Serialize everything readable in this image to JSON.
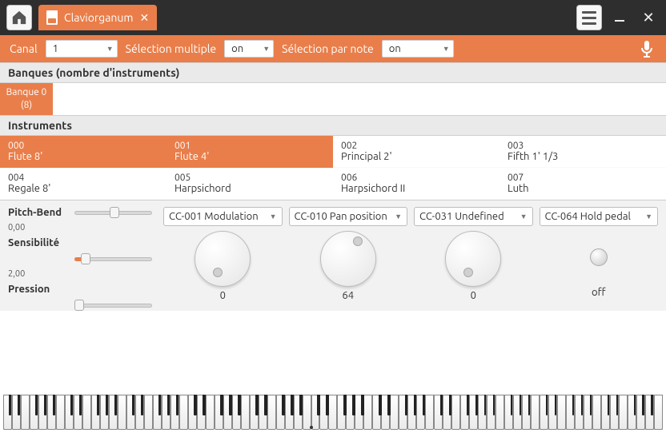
{
  "window": {
    "tab_title": "Claviorganum"
  },
  "selbar": {
    "canal_label": "Canal",
    "canal_value": "1",
    "multi_label": "Sélection multiple",
    "multi_value": "on",
    "note_label": "Sélection par note",
    "note_value": "on"
  },
  "sections": {
    "banks_header": "Banques (nombre d'instruments)",
    "instruments_header": "Instruments"
  },
  "bank": {
    "line1": "Banque 0",
    "line2": "(8)"
  },
  "instruments": [
    {
      "num": "000",
      "name": "Flute 8'",
      "selected": true
    },
    {
      "num": "001",
      "name": "Flute 4'",
      "selected": true
    },
    {
      "num": "002",
      "name": "Principal 2'",
      "selected": false
    },
    {
      "num": "003",
      "name": "Fifth 1' 1/3",
      "selected": false
    },
    {
      "num": "004",
      "name": "Regale 8'",
      "selected": false
    },
    {
      "num": "005",
      "name": "Harpsichord",
      "selected": false
    },
    {
      "num": "006",
      "name": "Harpsichord II",
      "selected": false
    },
    {
      "num": "007",
      "name": "Luth",
      "selected": false
    }
  ],
  "controls": {
    "pitchbend_label": "Pitch-Bend",
    "pitchbend_value": "0,00",
    "sensibility_label": "Sensibilité",
    "sensibility_value": "2,00",
    "pressure_label": "Pression"
  },
  "cc": [
    {
      "label": "CC-001 Modulation",
      "value": "0"
    },
    {
      "label": "CC-010 Pan position",
      "value": "64"
    },
    {
      "label": "CC-031 Undefined",
      "value": "0"
    },
    {
      "label": "CC-064 Hold pedal",
      "value": "off"
    }
  ]
}
